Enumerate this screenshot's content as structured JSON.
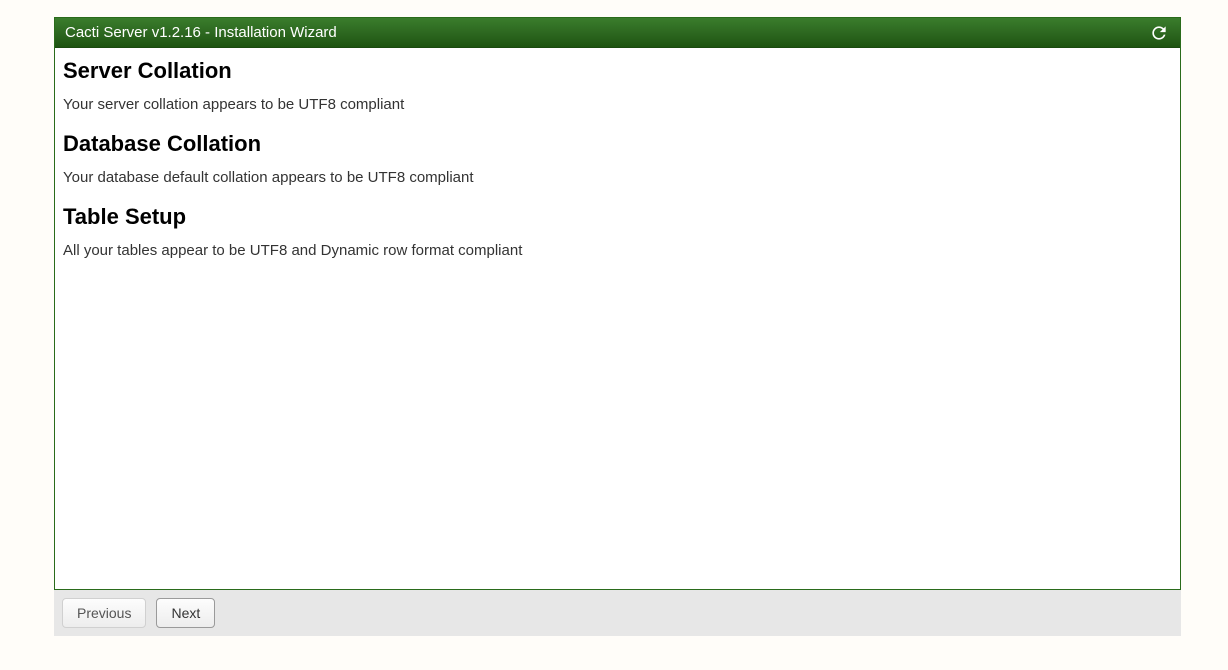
{
  "header": {
    "title": "Cacti Server v1.2.16 - Installation Wizard"
  },
  "sections": {
    "server_collation": {
      "heading": "Server Collation",
      "text": "Your server collation appears to be UTF8 compliant"
    },
    "database_collation": {
      "heading": "Database Collation",
      "text": "Your database default collation appears to be UTF8 compliant"
    },
    "table_setup": {
      "heading": "Table Setup",
      "text": "All your tables appear to be UTF8 and Dynamic row format compliant"
    }
  },
  "footer": {
    "previous_label": "Previous",
    "next_label": "Next"
  }
}
